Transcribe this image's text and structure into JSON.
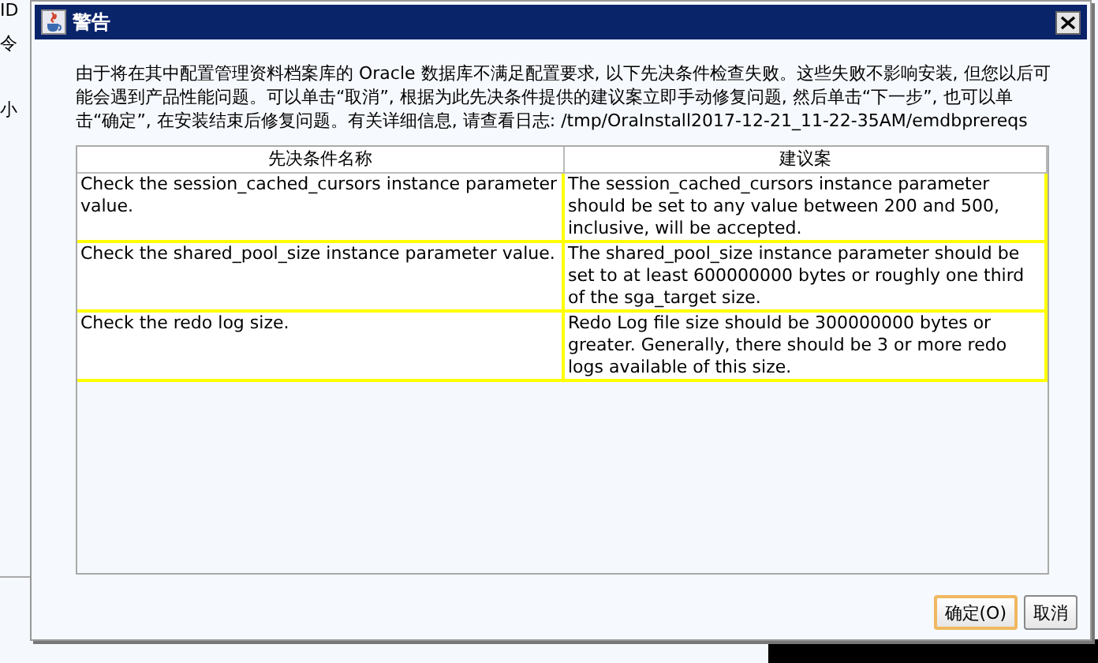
{
  "background_window": {
    "labels": [
      "ID",
      "令",
      "小"
    ]
  },
  "window": {
    "title": "警告"
  },
  "message": "由于将在其中配置管理资料档案库的 Oracle 数据库不满足配置要求, 以下先决条件检查失败。这些失败不影响安装, 但您以后可能会遇到产品性能问题。可以单击“取消”, 根据为此先决条件提供的建议案立即手动修复问题, 然后单击“下一步”, 也可以单击“确定”, 在安装结束后修复问题。有关详细信息, 请查看日志: /tmp/OraInstall2017-12-21_11-22-35AM/emdbprereqs",
  "table": {
    "columns": [
      "先决条件名称",
      "建议案"
    ],
    "rows": [
      {
        "check": "Check the session_cached_cursors instance parameter value.",
        "recommendation": "The session_cached_cursors instance parameter should be set to any value between 200 and 500, inclusive, will be accepted."
      },
      {
        "check": "Check the shared_pool_size instance parameter value.",
        "recommendation": "The shared_pool_size instance parameter should be set to at least 600000000 bytes or roughly one third of the sga_target size."
      },
      {
        "check": "Check the redo log size.",
        "recommendation": "Redo Log file size should be 300000000 bytes or greater.  Generally, there should be 3 or more redo logs available of this size."
      }
    ]
  },
  "buttons": [
    {
      "label": "确定(O)",
      "default": true
    },
    {
      "label": "取消",
      "default": false
    }
  ]
}
